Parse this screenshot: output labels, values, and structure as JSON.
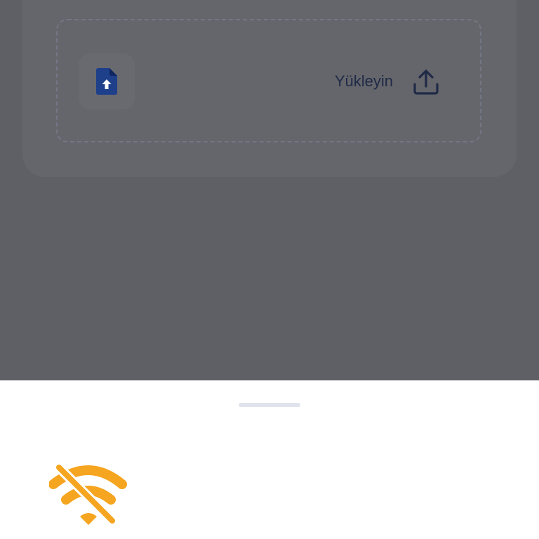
{
  "upload": {
    "label": "Yükleyin",
    "file_icon": "file-upload-icon",
    "action_icon": "upload-icon"
  },
  "sheet": {
    "status_icon": "wifi-off-icon"
  },
  "colors": {
    "overlay": "#5f6065",
    "card": "#65666b",
    "dashed_border": "#737684",
    "label_text": "#1f2a47",
    "file_icon": "#1e3f8a",
    "sheet_background": "#ffffff",
    "sheet_handle": "#dfe3ec",
    "warning_accent": "#f5a51f"
  }
}
